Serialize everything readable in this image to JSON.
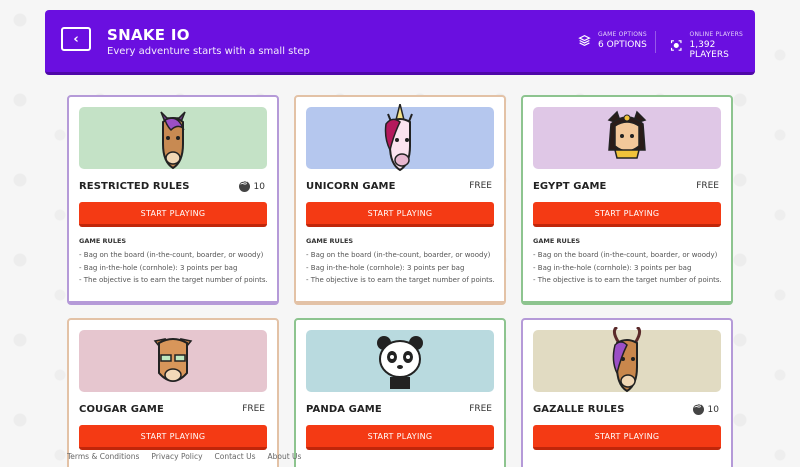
{
  "header": {
    "title": "SNAKE IO",
    "subtitle": "Every adventure starts with a small step",
    "back_icon": "chevron-left-icon",
    "stats": [
      {
        "label": "GAME OPTIONS",
        "value": "6 OPTIONS",
        "icon": "layers-icon"
      },
      {
        "label": "ONLINE PLAYERS",
        "value": "1,392 PLAYERS",
        "icon": "target-icon"
      }
    ]
  },
  "cards": [
    {
      "name": "RESTRICTED RULES",
      "price": "10",
      "price_type": "coin",
      "play_label": "START PLAYING",
      "rules_title": "GAME RULES",
      "rules": [
        "Bag on the board (in-the-count, boarder, or woody)",
        "Bag in-the-hole (cornhole): 3 points per bag",
        "The objective is to earn the target number of points."
      ],
      "bg": "#c4e2c6",
      "border": "#b59ad8",
      "avatar": "horse-icon"
    },
    {
      "name": "UNICORN GAME",
      "price": "FREE",
      "price_type": "free",
      "play_label": "START PLAYING",
      "rules_title": "GAME RULES",
      "rules": [
        "Bag on the board (in-the-count, boarder, or woody)",
        "Bag in-the-hole (cornhole): 3 points per bag",
        "The objective is to earn the target number of points."
      ],
      "bg": "#b5c7ee",
      "border": "#e3c2a6",
      "avatar": "unicorn-icon"
    },
    {
      "name": "EGYPT GAME",
      "price": "FREE",
      "price_type": "free",
      "play_label": "START PLAYING",
      "rules_title": "GAME RULES",
      "rules": [
        "Bag on the board (in-the-count, boarder, or woody)",
        "Bag in-the-hole (cornhole): 3 points per bag",
        "The objective is to earn the target number of points."
      ],
      "bg": "#dfc7e6",
      "border": "#8dc48f",
      "avatar": "egyptian-cat-icon"
    },
    {
      "name": "COUGAR GAME",
      "price": "FREE",
      "price_type": "free",
      "play_label": "START PLAYING",
      "bg": "#e6c6cf",
      "border": "#e3c2a6",
      "avatar": "cougar-icon"
    },
    {
      "name": "PANDA GAME",
      "price": "FREE",
      "price_type": "free",
      "play_label": "START PLAYING",
      "bg": "#b9dadf",
      "border": "#8dc48f",
      "avatar": "panda-icon"
    },
    {
      "name": "GAZALLE RULES",
      "price": "10",
      "price_type": "coin",
      "play_label": "START PLAYING",
      "bg": "#e1dbc2",
      "border": "#b59ad8",
      "avatar": "gazelle-icon"
    }
  ],
  "footer": {
    "links": [
      "Terms & Conditions",
      "Privacy Policy",
      "Contact Us",
      "About Us"
    ]
  },
  "colors": {
    "header": "#6a0fe0",
    "play_button": "#f43a14"
  }
}
